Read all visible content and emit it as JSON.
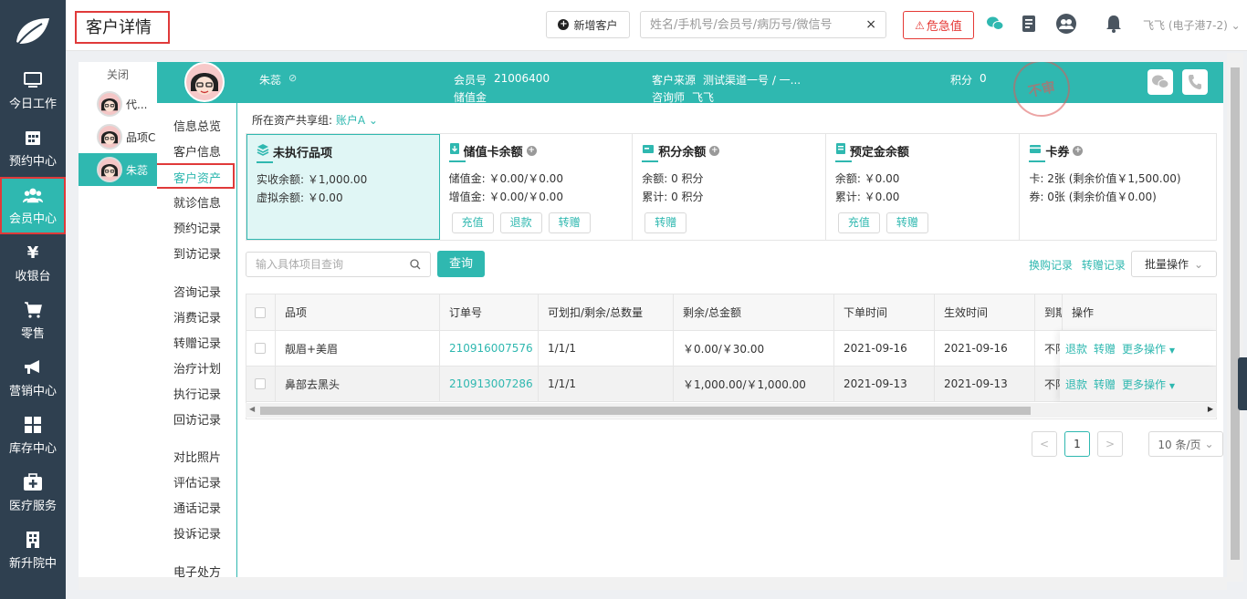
{
  "sidebar": {
    "items": [
      {
        "label": "今日工作",
        "icon": "monitor-icon"
      },
      {
        "label": "预约中心",
        "icon": "calendar-icon"
      },
      {
        "label": "会员中心",
        "icon": "users-icon",
        "active": true
      },
      {
        "label": "收银台",
        "icon": "yen-icon",
        "glyph": "¥"
      },
      {
        "label": "零售",
        "icon": "cart-icon"
      },
      {
        "label": "营销中心",
        "icon": "megaphone-icon"
      },
      {
        "label": "库存中心",
        "icon": "grid-icon"
      },
      {
        "label": "医疗服务",
        "icon": "medkit-icon"
      },
      {
        "label": "新升院中",
        "icon": "building-icon"
      }
    ]
  },
  "header": {
    "title": "客户详情",
    "new_customer": "新增客户",
    "search_placeholder": "姓名/手机号/会员号/病历号/微信号",
    "clear": "×",
    "danger_label": "危急值",
    "user": "飞飞 (电子港7-2)",
    "user_caret": "⌄"
  },
  "customer_tabs": {
    "close_label": "关闭",
    "tabs": [
      {
        "name": "代..."
      },
      {
        "name": "品项C"
      },
      {
        "name": "朱蕊",
        "active": true
      }
    ]
  },
  "customer": {
    "name": "朱蕊",
    "member_no_label": "会员号",
    "member_no": "21006400",
    "stored_label": "储值金",
    "source_label": "客户来源",
    "source": "测试渠道一号 / 一...",
    "consultant_label": "咨询师",
    "consultant": "飞飞",
    "points_label": "积分",
    "points": "0",
    "stamp_text": "不审"
  },
  "submenu": {
    "items": [
      "信息总览",
      "客户信息",
      "客户资产",
      "就诊信息",
      "预约记录",
      "到访记录",
      "咨询记录",
      "消费记录",
      "转赠记录",
      "治疗计划",
      "执行记录",
      "回访记录",
      "对比照片",
      "评估记录",
      "通话记录",
      "投诉记录",
      "电子处方"
    ],
    "active": "客户资产"
  },
  "asset": {
    "group_label": "所在资产共享组:",
    "group_value": "账户A",
    "cards": [
      {
        "title": "未执行品项",
        "lines": [
          "实收余额: ￥1,000.00",
          "虚拟余额: ￥0.00"
        ],
        "buttons": [],
        "has_add": false
      },
      {
        "title": "储值卡余额",
        "lines": [
          "储值金: ￥0.00/￥0.00",
          "增值金: ￥0.00/￥0.00"
        ],
        "buttons": [
          "充值",
          "退款",
          "转赠"
        ],
        "has_add": true
      },
      {
        "title": "积分余额",
        "lines": [
          "余额: 0 积分",
          "累计: 0 积分"
        ],
        "buttons": [
          "转赠"
        ],
        "has_add": true
      },
      {
        "title": "预定金余额",
        "lines": [
          "余额: ￥0.00",
          "累计: ￥0.00"
        ],
        "buttons": [
          "充值",
          "转赠"
        ],
        "has_add": false
      },
      {
        "title": "卡券",
        "lines": [
          "卡: 2张 (剩余价值￥1,500.00)",
          "券: 0张 (剩余价值￥0.00)"
        ],
        "buttons": [],
        "has_add": true
      }
    ]
  },
  "toolbar": {
    "item_search_placeholder": "输入具体项目查询",
    "query_label": "查询",
    "exchange_log": "换购记录",
    "transfer_log": "转赠记录",
    "batch_label": "批量操作"
  },
  "table": {
    "columns": [
      "品项",
      "订单号",
      "可划扣/剩余/总数量",
      "剩余/总金额",
      "下单时间",
      "生效时间",
      "到期",
      "操作"
    ],
    "rows": [
      {
        "item": "靓眉+美眉",
        "order": "210916007576",
        "qty": "1/1/1",
        "amount": "￥0.00/￥30.00",
        "ordered": "2021-09-16",
        "effective": "2021-09-16",
        "expiry": "不限"
      },
      {
        "item": "鼻部去黑头",
        "order": "210913007286",
        "qty": "1/1/1",
        "amount": "￥1,000.00/￥1,000.00",
        "ordered": "2021-09-13",
        "effective": "2021-09-13",
        "expiry": "不限"
      }
    ],
    "actions": [
      "退款",
      "转赠",
      "更多操作"
    ]
  },
  "pagination": {
    "prev": "<",
    "current": "1",
    "next": ">",
    "page_size": "10 条/页"
  },
  "colors": {
    "accent": "#2fb8b0",
    "sidebar": "#2f4050",
    "danger": "#e53935"
  }
}
